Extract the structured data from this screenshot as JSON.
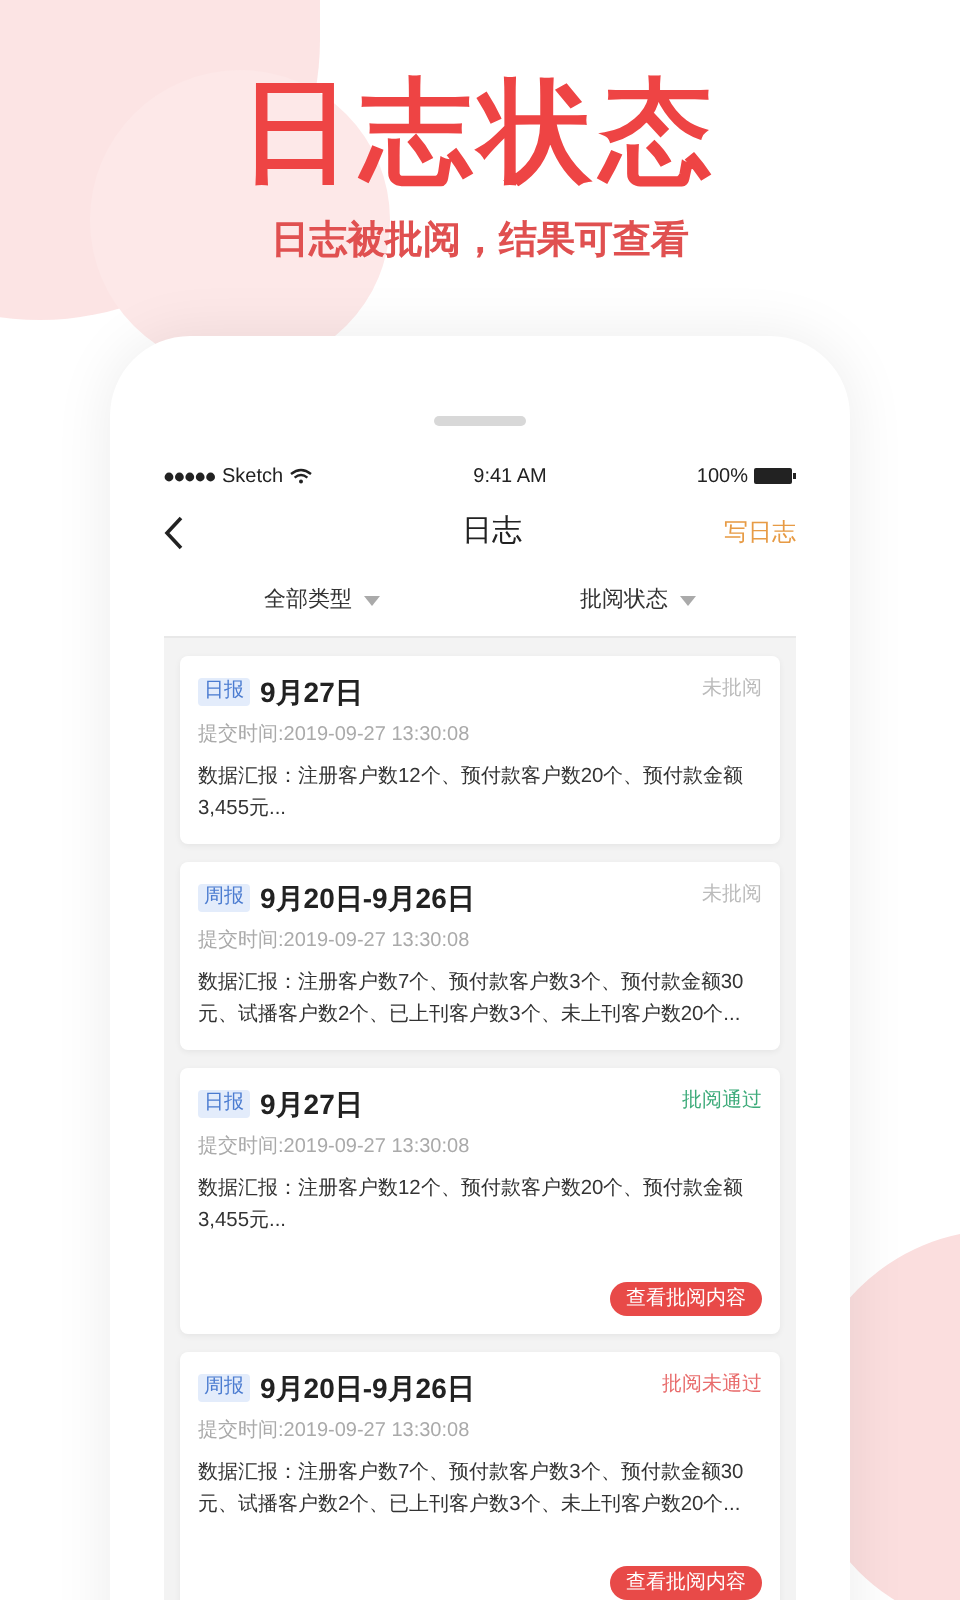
{
  "headline": "日志状态",
  "subheadline": "日志被批阅，结果可查看",
  "status_bar": {
    "carrier": "Sketch",
    "time": "9:41 AM",
    "battery": "100%"
  },
  "nav": {
    "title": "日志",
    "action": "写日志"
  },
  "filters": [
    {
      "label": "全部类型"
    },
    {
      "label": "批阅状态"
    }
  ],
  "reports": [
    {
      "tag": "日报",
      "title": "9月27日",
      "submitted": "提交时间:2019-09-27 13:30:08",
      "summary": "数据汇报：注册客户数12个、预付款客户数20个、预付款金额3,455元...",
      "status": {
        "kind": "pending",
        "text": "未批阅"
      }
    },
    {
      "tag": "周报",
      "title": "9月20日-9月26日",
      "submitted": "提交时间:2019-09-27 13:30:08",
      "summary": "数据汇报：注册客户数7个、预付款客户数3个、预付款金额30元、试播客户数2个、已上刊客户数3个、未上刊客户数20个...",
      "status": {
        "kind": "pending",
        "text": "未批阅"
      }
    },
    {
      "tag": "日报",
      "title": "9月27日",
      "submitted": "提交时间:2019-09-27 13:30:08",
      "summary": "数据汇报：注册客户数12个、预付款客户数20个、预付款金额3,455元...",
      "status": {
        "kind": "approved",
        "text": "批阅通过"
      },
      "button": "查看批阅内容"
    },
    {
      "tag": "周报",
      "title": "9月20日-9月26日",
      "submitted": "提交时间:2019-09-27 13:30:08",
      "summary": "数据汇报：注册客户数7个、预付款客户数3个、预付款金额30元、试播客户数2个、已上刊客户数3个、未上刊客户数20个...",
      "status": {
        "kind": "rejected",
        "text": "批阅未通过"
      },
      "button": "查看批阅内容"
    }
  ]
}
